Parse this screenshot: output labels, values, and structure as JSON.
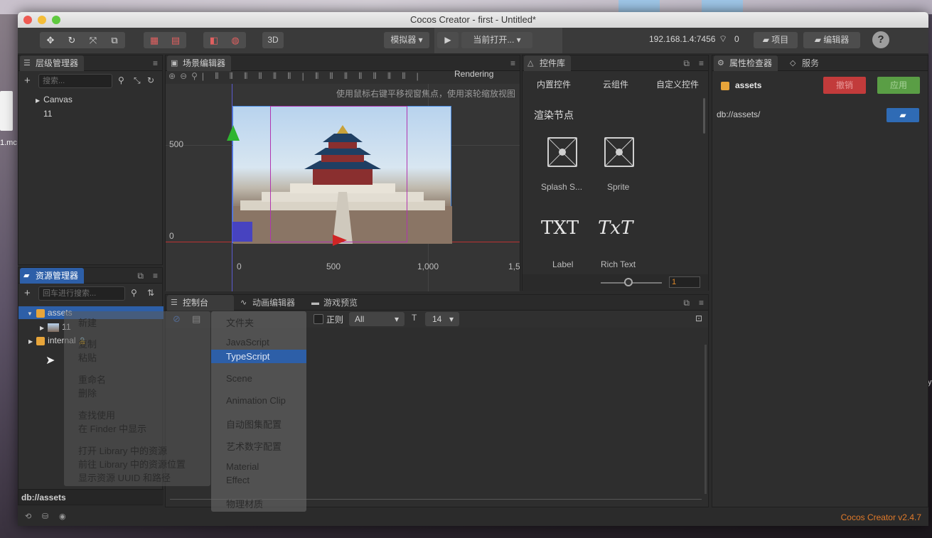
{
  "window": {
    "title": "Cocos Creator - first - Untitled*"
  },
  "toolbar": {
    "btn_3d": "3D",
    "simulator": "模拟器 ▾",
    "play_icon": "play-icon",
    "current_open": "当前打开... ▾",
    "ip": "192.168.1.4:7456",
    "wifi_count": "0",
    "project": "项目",
    "editor": "编辑器",
    "help": "?"
  },
  "hierarchy": {
    "tab": "层级管理器",
    "search_placeholder": "搜索...",
    "items": [
      "Canvas",
      "11"
    ]
  },
  "assets": {
    "tab": "资源管理器",
    "search_placeholder": "回车进行搜索...",
    "items": [
      "assets",
      "11",
      "internal"
    ],
    "footer": "db://assets"
  },
  "scene": {
    "tab": "场景编辑器",
    "rendering": "Rendering",
    "hint": "使用鼠标右键平移视窗焦点，使用滚轮缩放视图",
    "axis_y": [
      "500",
      "0"
    ],
    "axis_x": [
      "0",
      "500",
      "1,000",
      "1,5"
    ]
  },
  "widget_lib": {
    "tab": "控件库",
    "tabs": [
      "内置控件",
      "云组件",
      "自定义控件"
    ],
    "section": "渲染节点",
    "items": [
      "Splash S...",
      "Sprite",
      "Label",
      "Rich Text"
    ],
    "label_glyph": "TXT",
    "richtext_glyph": "TxT",
    "zoom_value": "1"
  },
  "inspector": {
    "tab": "属性检查器",
    "tab2": "服务",
    "name": "assets",
    "revert": "撤销",
    "apply": "应用",
    "path": "db://assets/"
  },
  "console": {
    "tabs": [
      "控制台",
      "动画编辑器",
      "游戏预览"
    ],
    "regex": "正则",
    "filter": "All",
    "font_size": "14"
  },
  "context_menu": {
    "items": [
      "新建",
      "复制",
      "粘贴",
      "重命名",
      "删除",
      "查找使用",
      "在 Finder 中显示",
      "打开 Library 中的资源",
      "前往 Library 中的资源位置",
      "显示资源 UUID 和路径"
    ]
  },
  "submenu": {
    "items": [
      "文件夹",
      "JavaScript",
      "TypeScript",
      "Scene",
      "Animation Clip",
      "自动图集配置",
      "艺术数字配置",
      "Material",
      "Effect",
      "物理材质"
    ],
    "highlighted": "TypeScript"
  },
  "status": {
    "version": "Cocos Creator v2.4.7"
  },
  "colors": {
    "accent": "#2d5fa8",
    "revert": "#c23b3b",
    "apply": "#5a9e45",
    "version": "#e07a2a"
  },
  "desktop": {
    "left_label": "1.mc",
    "right_label": "y"
  }
}
